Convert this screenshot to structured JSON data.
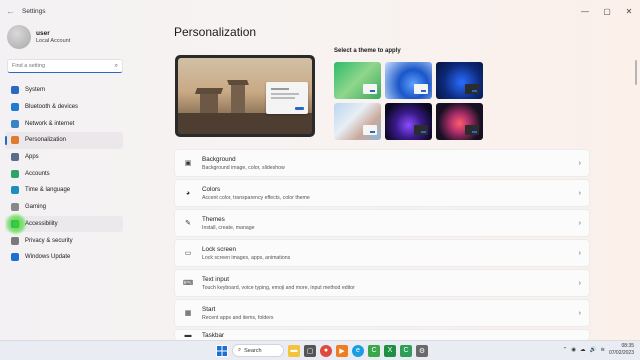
{
  "window": {
    "title": "Settings",
    "back_icon": "back-arrow-icon"
  },
  "profile": {
    "name": "user",
    "account_type": "Local Account"
  },
  "search": {
    "placeholder": "Find a setting"
  },
  "nav": [
    {
      "label": "System",
      "icon": "monitor-icon",
      "color": "#2a68c5"
    },
    {
      "label": "Bluetooth & devices",
      "icon": "bluetooth-icon",
      "color": "#1f7ad6"
    },
    {
      "label": "Network & internet",
      "icon": "wifi-icon",
      "color": "#3b82c4"
    },
    {
      "label": "Personalization",
      "icon": "brush-icon",
      "color": "#e07a2e",
      "active": true
    },
    {
      "label": "Apps",
      "icon": "apps-icon",
      "color": "#5a6c8a"
    },
    {
      "label": "Accounts",
      "icon": "person-icon",
      "color": "#2ea36b"
    },
    {
      "label": "Time & language",
      "icon": "globe-clock-icon",
      "color": "#1d8fbf"
    },
    {
      "label": "Gaming",
      "icon": "gamepad-icon",
      "color": "#888888"
    },
    {
      "label": "Accessibility",
      "icon": "accessibility-icon",
      "color": "#2a68c5"
    },
    {
      "label": "Privacy & security",
      "icon": "shield-icon",
      "color": "#7a7a7a"
    },
    {
      "label": "Windows Update",
      "icon": "update-icon",
      "color": "#1d6fd1"
    }
  ],
  "main": {
    "title": "Personalization",
    "theme_label": "Select a theme to apply",
    "cards": [
      {
        "title": "Background",
        "subtitle": "Background image, color, slideshow",
        "icon": "image-icon",
        "glyph": "▣"
      },
      {
        "title": "Colors",
        "subtitle": "Accent color, transparency effects, color theme",
        "icon": "palette-icon",
        "glyph": "◕"
      },
      {
        "title": "Themes",
        "subtitle": "Install, create, manage",
        "icon": "pen-icon",
        "glyph": "✎"
      },
      {
        "title": "Lock screen",
        "subtitle": "Lock screen images, apps, animations",
        "icon": "lock-screen-icon",
        "glyph": "▭"
      },
      {
        "title": "Text input",
        "subtitle": "Touch keyboard, voice typing, emoji and more, input method editor",
        "icon": "keyboard-icon",
        "glyph": "⌨"
      },
      {
        "title": "Start",
        "subtitle": "Recent apps and items, folders",
        "icon": "start-icon",
        "glyph": "▦"
      },
      {
        "title": "Taskbar",
        "subtitle": "",
        "icon": "taskbar-icon",
        "glyph": "▬"
      }
    ]
  },
  "taskbar": {
    "search_label": "Search",
    "time": "08:35",
    "date": "07/02/2023"
  }
}
